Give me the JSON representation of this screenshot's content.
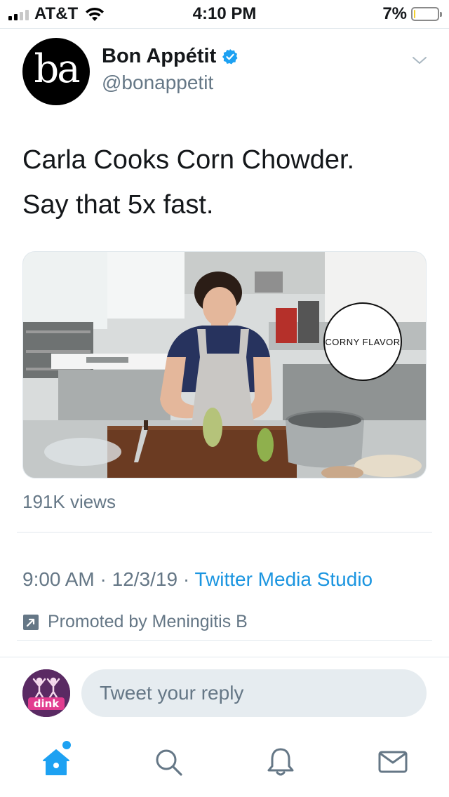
{
  "status_bar": {
    "carrier": "AT&T",
    "time": "4:10 PM",
    "battery_percent": "7%",
    "battery_level": 0.07,
    "signal_bars": 2
  },
  "tweet": {
    "avatar_text": "ba",
    "author_name": "Bon Appétit",
    "handle": "@bonappetit",
    "verified": true,
    "text_line1": "Carla Cooks Corn Chowder.",
    "text_line2": "Say that 5x fast.",
    "media_overlay_text": "CORNY FLAVOR",
    "views": "191K views",
    "time": "9:00 AM",
    "date": "12/3/19",
    "separator": " · ",
    "source": "Twitter Media Studio",
    "promoted": "Promoted by Meningitis B"
  },
  "reply": {
    "avatar_text": "dink",
    "placeholder": "Tweet your reply"
  },
  "tab_bar": {
    "items": [
      {
        "icon": "home-icon",
        "active": true
      },
      {
        "icon": "search-icon",
        "active": false
      },
      {
        "icon": "bell-icon",
        "active": false
      },
      {
        "icon": "mail-icon",
        "active": false
      }
    ]
  },
  "colors": {
    "accent": "#1da1f2",
    "link": "#1b95e0",
    "secondary_text": "#657786",
    "primary_text": "#14171a"
  }
}
